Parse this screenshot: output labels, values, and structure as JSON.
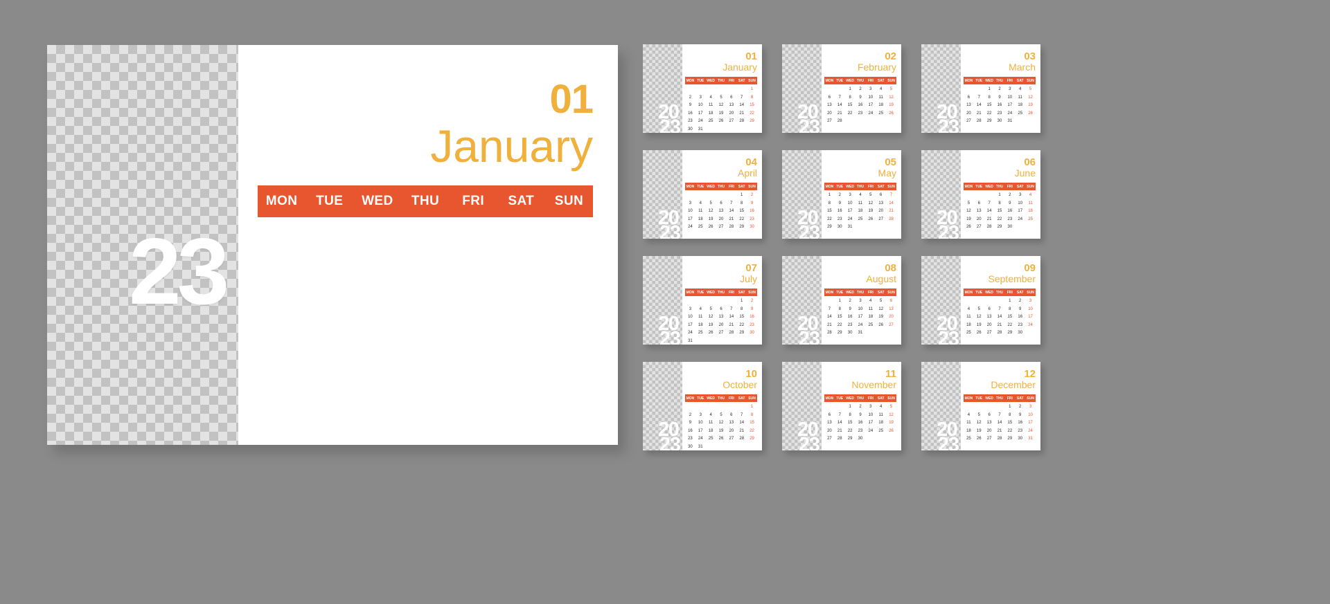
{
  "theme": {
    "background": "#8a8a8a",
    "accent_yellow": "#F0B03C",
    "accent_orange": "#E8562F",
    "card_background": "#ffffff",
    "date_text": "#1b1b1b"
  },
  "year": "2023",
  "year_top": "20",
  "year_bottom": "23",
  "weekdays": [
    "MON",
    "TUE",
    "WED",
    "THU",
    "FRI",
    "SAT",
    "SUN"
  ],
  "hero": {
    "month_number": "01",
    "month_name": "January",
    "year_top": "20",
    "year_bottom": "23",
    "lead_blanks": 6,
    "days_in_month": 31
  },
  "months": [
    {
      "number": "01",
      "name": "January",
      "lead_blanks": 6,
      "days": 31
    },
    {
      "number": "02",
      "name": "February",
      "lead_blanks": 2,
      "days": 28
    },
    {
      "number": "03",
      "name": "March",
      "lead_blanks": 2,
      "days": 31
    },
    {
      "number": "04",
      "name": "April",
      "lead_blanks": 5,
      "days": 30
    },
    {
      "number": "05",
      "name": "May",
      "lead_blanks": 0,
      "days": 31
    },
    {
      "number": "06",
      "name": "June",
      "lead_blanks": 3,
      "days": 30
    },
    {
      "number": "07",
      "name": "July",
      "lead_blanks": 5,
      "days": 31
    },
    {
      "number": "08",
      "name": "August",
      "lead_blanks": 1,
      "days": 31
    },
    {
      "number": "09",
      "name": "September",
      "lead_blanks": 4,
      "days": 30
    },
    {
      "number": "10",
      "name": "October",
      "lead_blanks": 6,
      "days": 31
    },
    {
      "number": "11",
      "name": "November",
      "lead_blanks": 2,
      "days": 30
    },
    {
      "number": "12",
      "name": "December",
      "lead_blanks": 4,
      "days": 31
    }
  ]
}
